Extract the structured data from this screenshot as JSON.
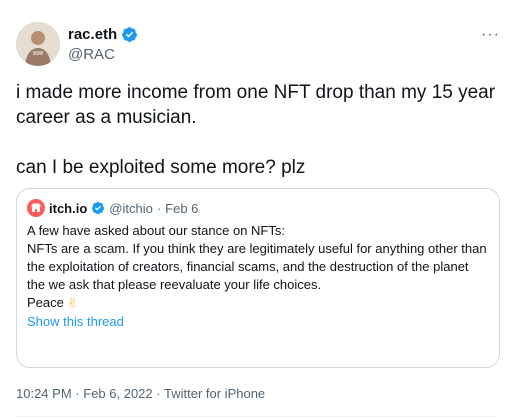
{
  "author": {
    "display_name": "rac.eth",
    "handle": "@RAC",
    "verified": true
  },
  "more_label": "···",
  "tweet_text": "i made more income from one NFT drop than my 15 year career as a musician.\n\ncan I be exploited some more? plz",
  "quoted": {
    "display_name": "itch.io",
    "handle": "@itchio",
    "separator": "·",
    "date": "Feb 6",
    "intro": "A few have asked about our stance on NFTs:",
    "body": "NFTs are a scam. If you think they are legitimately useful for anything other than the exploitation of creators, financial scams, and the destruction of the planet the we ask that please reevaluate your life choices.",
    "signoff": "Peace",
    "signoff_emoji": "✌",
    "show_thread": "Show this thread"
  },
  "footer": {
    "time": "10:24 PM",
    "separator": "·",
    "date": "Feb 6, 2022",
    "source": "Twitter for iPhone"
  },
  "colors": {
    "text": "#0f1419",
    "secondary": "#536471",
    "link": "#1d9bf0",
    "border": "#cfd9de",
    "itch_brand": "#fa5c5c"
  },
  "icons": [
    "verified-badge-icon",
    "itchio-logo-icon",
    "more-options-icon",
    "avatar"
  ]
}
